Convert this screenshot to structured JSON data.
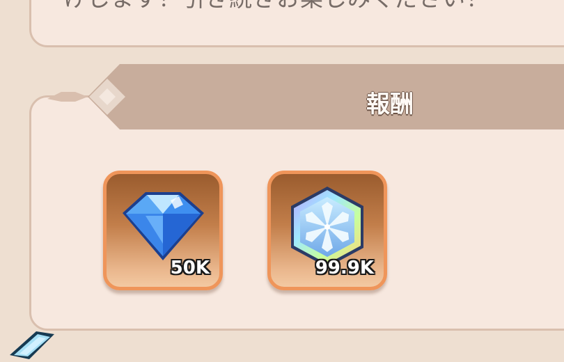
{
  "message": {
    "text": "けします！引き続きお楽しみください！"
  },
  "rewards": {
    "title": "報酬",
    "items": [
      {
        "name": "diamond",
        "icon": "blue-diamond-icon",
        "quantity": "50K"
      },
      {
        "name": "crystal",
        "icon": "snowflake-crystal-icon",
        "quantity": "99.9K"
      }
    ]
  },
  "colors": {
    "background": "#eedfd1",
    "panel": "#f7e8df",
    "panel_border": "#d9bfae",
    "header_band": "#c8ad9c",
    "item_border": "#ef955a"
  }
}
